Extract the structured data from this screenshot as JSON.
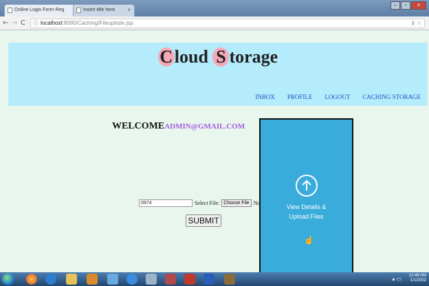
{
  "browser": {
    "tabs": [
      {
        "label": "Online Login Form Reg"
      },
      {
        "label": "Insert title here"
      }
    ],
    "url_host": "localhost",
    "url_path": ":8080/Caching/Fileuplode.jsp"
  },
  "header": {
    "title_letter_1": "C",
    "title_rest_1": "loud ",
    "title_letter_2": "S",
    "title_rest_2": "torage",
    "nav": [
      "INBOX",
      "PROFILE",
      "LOGOUT",
      "CACHING STORAGE"
    ]
  },
  "main": {
    "welcome": "WELCOME",
    "email": "ADMIN@GMAIL.COM",
    "id_value": "0974",
    "select_label": "Select File:",
    "choose_label": "Choose File",
    "no_file_label": "No file c",
    "submit_label": "SUBMIT"
  },
  "card": {
    "line1": "View Details &",
    "line2": "Upload Files"
  },
  "taskbar": {
    "time": "12:46 AM",
    "date": "1/1/2002"
  },
  "colors": {
    "header_bg": "#b4ecfb",
    "page_bg": "#e8f6ee",
    "card_bg": "#3aacdc",
    "nav_link": "#1a4fc4",
    "email": "#a65de0"
  }
}
